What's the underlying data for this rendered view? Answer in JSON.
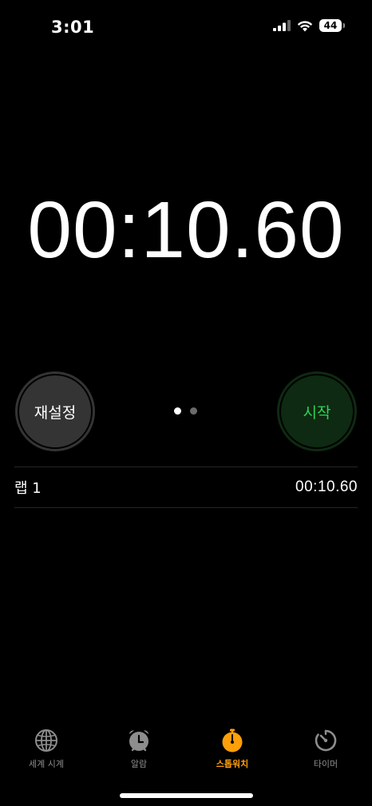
{
  "status_bar": {
    "time": "3:01",
    "battery_level": "44",
    "icons": [
      "cellular-signal-icon",
      "wifi-icon",
      "battery-icon"
    ]
  },
  "stopwatch": {
    "elapsed": "00:10.60"
  },
  "buttons": {
    "reset_label": "재설정",
    "start_label": "시작"
  },
  "pager": {
    "pages": 2,
    "current": 1
  },
  "laps": [
    {
      "label": "랩 1",
      "time": "00:10.60"
    }
  ],
  "tabs": [
    {
      "label": "세계 시계",
      "icon": "globe-icon",
      "active": false
    },
    {
      "label": "알람",
      "icon": "alarm-clock-icon",
      "active": false
    },
    {
      "label": "스톱워치",
      "icon": "stopwatch-icon",
      "active": true
    },
    {
      "label": "타이머",
      "icon": "timer-icon",
      "active": false
    }
  ],
  "colors": {
    "background": "#000000",
    "accent": "#ff9f0a",
    "start_green": "#31d158",
    "start_bg": "#0e2a12",
    "reset_bg": "#343434",
    "inactive_tab": "#8d8d8d"
  }
}
